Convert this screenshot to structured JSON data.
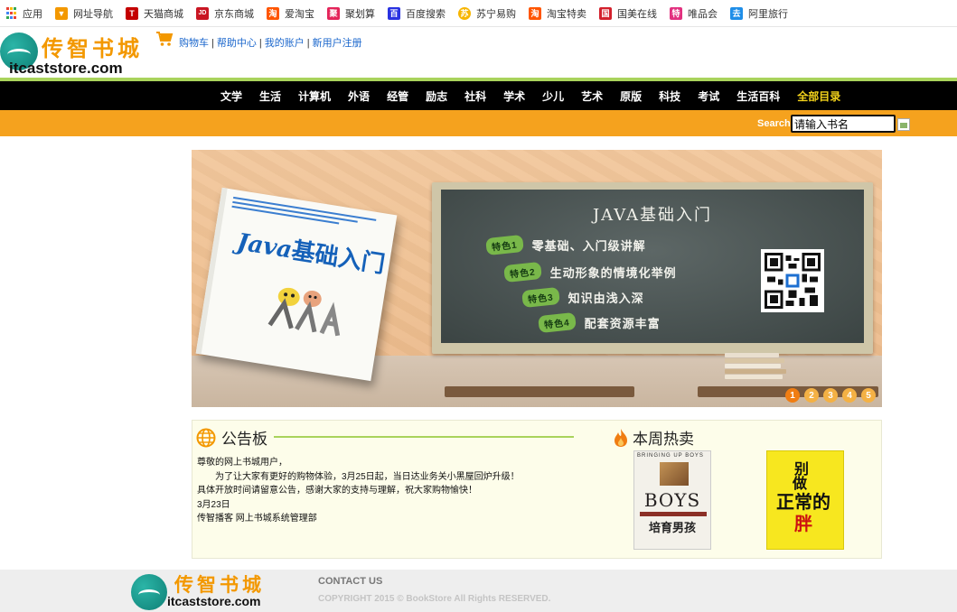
{
  "bookmarks": [
    {
      "label": "应用",
      "icon": "apps-grid-icon"
    },
    {
      "label": "网址导航",
      "icon": "bookmark-icon",
      "color": "#f39800"
    },
    {
      "label": "天猫商城",
      "icon": "tmall-icon",
      "color": "#c40000",
      "glyph": "T"
    },
    {
      "label": "京东商城",
      "icon": "jd-icon",
      "color": "#c91623",
      "glyph": "JD"
    },
    {
      "label": "爱淘宝",
      "icon": "taobao-icon",
      "color": "#ff5500",
      "glyph": "淘"
    },
    {
      "label": "聚划算",
      "icon": "juhuasuan-icon",
      "color": "#e4245a",
      "glyph": "聚"
    },
    {
      "label": "百度搜索",
      "icon": "baidu-icon",
      "color": "#2932e1",
      "glyph": "百"
    },
    {
      "label": "苏宁易购",
      "icon": "suning-icon",
      "color": "#f7b500",
      "glyph": "苏"
    },
    {
      "label": "淘宝特卖",
      "icon": "taobao-sale-icon",
      "color": "#ff5500",
      "glyph": "淘"
    },
    {
      "label": "国美在线",
      "icon": "gome-icon",
      "color": "#d3202c",
      "glyph": "国"
    },
    {
      "label": "唯品会",
      "icon": "vip-icon",
      "color": "#e2307f",
      "glyph": "特"
    },
    {
      "label": "阿里旅行",
      "icon": "alitrip-icon",
      "color": "#1f8ee8",
      "glyph": "去"
    }
  ],
  "header": {
    "logo_cn": "传智书城",
    "logo_en": "itcaststore.com",
    "links": [
      "购物车",
      "帮助中心",
      "我的账户",
      "新用户注册"
    ],
    "separator": "|"
  },
  "nav": {
    "items": [
      "文学",
      "生活",
      "计算机",
      "外语",
      "经管",
      "励志",
      "社科",
      "学术",
      "少儿",
      "艺术",
      "原版",
      "科技",
      "考试",
      "生活百科"
    ],
    "all_label": "全部目录"
  },
  "search": {
    "label": "Search",
    "value": "请输入书名"
  },
  "banner": {
    "board_title": "JAVA基础入门",
    "features": [
      {
        "tag": "特色1",
        "text": "零基础、入门级讲解"
      },
      {
        "tag": "特色2",
        "text": "生动形象的情境化举例"
      },
      {
        "tag": "特色3",
        "text": "知识由浅入深"
      },
      {
        "tag": "特色4",
        "text": "配套资源丰富"
      }
    ],
    "book_title_en": "Java",
    "book_title_cn": "基础入门",
    "slides": [
      "1",
      "2",
      "3",
      "4",
      "5"
    ],
    "active_slide": 0
  },
  "notice": {
    "title": "公告板",
    "lines": [
      "尊敬的网上书城用户，",
      "为了让大家有更好的购物体验，3月25日起，当日达业务关小黑屋回炉升级！",
      "具体开放时间请留意公告，感谢大家的支持与理解，祝大家购物愉快！",
      "3月23日",
      "传智播客 网上书城系统管理部"
    ]
  },
  "hot": {
    "title": "本周热卖",
    "books": [
      {
        "top": "BRINGING UP BOYS",
        "title": "BOYS",
        "cn": "培育男孩"
      },
      {
        "c1": "别",
        "c2": "做",
        "c3": "正常的",
        "c4": "胖"
      }
    ]
  },
  "footer": {
    "logo_cn": "传智书城",
    "logo_en": "itcaststore.com",
    "contact": "CONTACT US",
    "copyright": "COPYRIGHT 2015 © BookStore All Rights RESERVED."
  },
  "colors": {
    "accent_orange": "#f5a21e",
    "nav_black": "#000000",
    "green_line": "#a9d35c",
    "link_blue": "#1a66cc"
  }
}
